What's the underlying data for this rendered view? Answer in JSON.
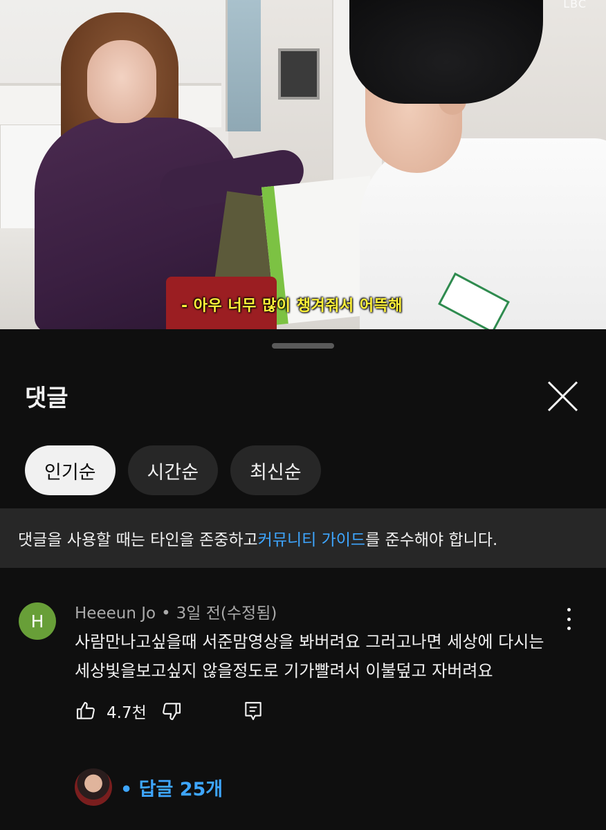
{
  "video": {
    "subtitle": "- 아우 너무 많이 챙겨줘서 어뜩해",
    "watermark": "LBC"
  },
  "sheet": {
    "title": "댓글"
  },
  "sort_chips": [
    {
      "label": "인기순",
      "selected": true
    },
    {
      "label": "시간순",
      "selected": false
    },
    {
      "label": "최신순",
      "selected": false
    }
  ],
  "guideline": {
    "before": "댓글을 사용할 때는 타인을 존중하고 ",
    "link": "커뮤니티 가이드",
    "after": "를 준수해야 합니다."
  },
  "comment": {
    "avatar_letter": "H",
    "author": "Heeeun Jo",
    "separator": "•",
    "time": "3일 전(수정됨)",
    "text": "사람만나고싶을때 서준맘영상을 봐버려요 그러고나면 세상에 다시는 세상빛을보고싶지 않을정도로 기가빨려서 이불덮고 자버려요",
    "likes": "4.7천",
    "replies_label": "• 답글 25개"
  },
  "colors": {
    "background": "#0f0f0f",
    "surface": "#272727",
    "link": "#3ea6ff",
    "avatar": "#689f38",
    "subtitle": "#fff23a"
  },
  "icons": [
    "close-icon",
    "thumbs-up-icon",
    "thumbs-down-icon",
    "comment-reply-icon",
    "more-vert-icon"
  ]
}
